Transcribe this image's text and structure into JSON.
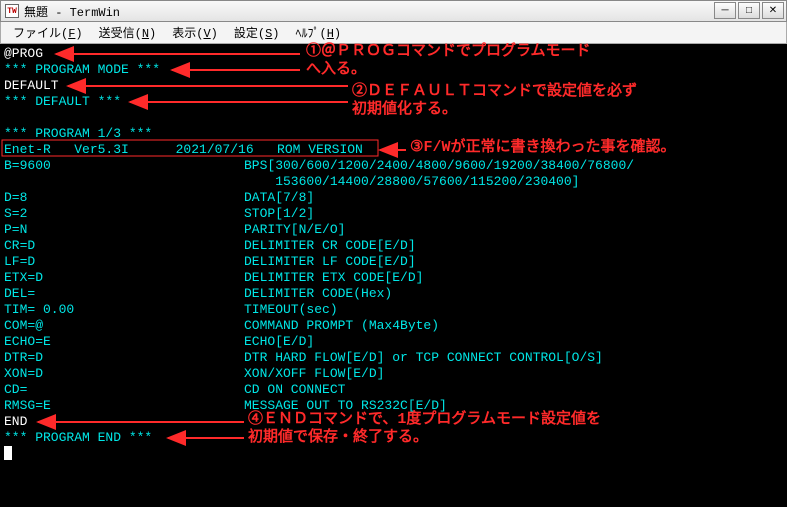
{
  "window": {
    "title": "無題 - TermWin",
    "icon_label": "TW"
  },
  "menu": {
    "file": {
      "label": "ファイル",
      "accel": "F"
    },
    "send": {
      "label": "送受信",
      "accel": "N"
    },
    "view": {
      "label": "表示",
      "accel": "V"
    },
    "setting": {
      "label": "設定",
      "accel": "S"
    },
    "help": {
      "label": "ﾍﾙﾌﾟ",
      "accel": "H"
    }
  },
  "term": {
    "l1": "@PROG",
    "l2": "*** PROGRAM MODE ***",
    "l3": "DEFAULT",
    "l4": "*** DEFAULT ***",
    "l5": "*** PROGRAM 1/3 ***",
    "l6": "Enet-R   Ver5.3I      2021/07/16   ROM VERSION",
    "b_k": "B=9600",
    "b_v": "BPS[300/600/1200/2400/4800/9600/19200/38400/76800/",
    "b_v2": "    153600/14400/28800/57600/115200/230400]",
    "d_k": "D=8",
    "d_v": "DATA[7/8]",
    "s_k": "S=2",
    "s_v": "STOP[1/2]",
    "p_k": "P=N",
    "p_v": "PARITY[N/E/O]",
    "cr_k": "CR=D",
    "cr_v": "DELIMITER CR CODE[E/D]",
    "lf_k": "LF=D",
    "lf_v": "DELIMITER LF CODE[E/D]",
    "etx_k": "ETX=D",
    "etx_v": "DELIMITER ETX CODE[E/D]",
    "del_k": "DEL=",
    "del_v": "DELIMITER CODE(Hex)",
    "tim_k": "TIM= 0.00",
    "tim_v": "TIMEOUT(sec)",
    "com_k": "COM=@",
    "com_v": "COMMAND PROMPT (Max4Byte)",
    "echo_k": "ECHO=E",
    "echo_v": "ECHO[E/D]",
    "dtr_k": "DTR=D",
    "dtr_v": "DTR HARD FLOW[E/D] or TCP CONNECT CONTROL[O/S]",
    "xon_k": "XON=D",
    "xon_v": "XON/XOFF FLOW[E/D]",
    "cd_k": "CD=",
    "cd_v": "CD ON CONNECT",
    "rmsg_k": "RMSG=E",
    "rmsg_v": "MESSAGE OUT TO RS232C[E/D]",
    "end": "END",
    "progend": "*** PROGRAM END ***"
  },
  "anno": {
    "a1a": "①＠ＰＲＯＧコマンドでプログラムモード",
    "a1b": "へ入る。",
    "a2a": "②ＤＥＦＡＵＬＴコマンドで設定値を必ず",
    "a2b": "初期値化する。",
    "a3": "③F/Wが正常に書き換わった事を確認。",
    "a4a": "④ＥＮＤコマンドで、1度プログラムモード設定値を",
    "a4b": "初期値で保存・終了する。"
  }
}
